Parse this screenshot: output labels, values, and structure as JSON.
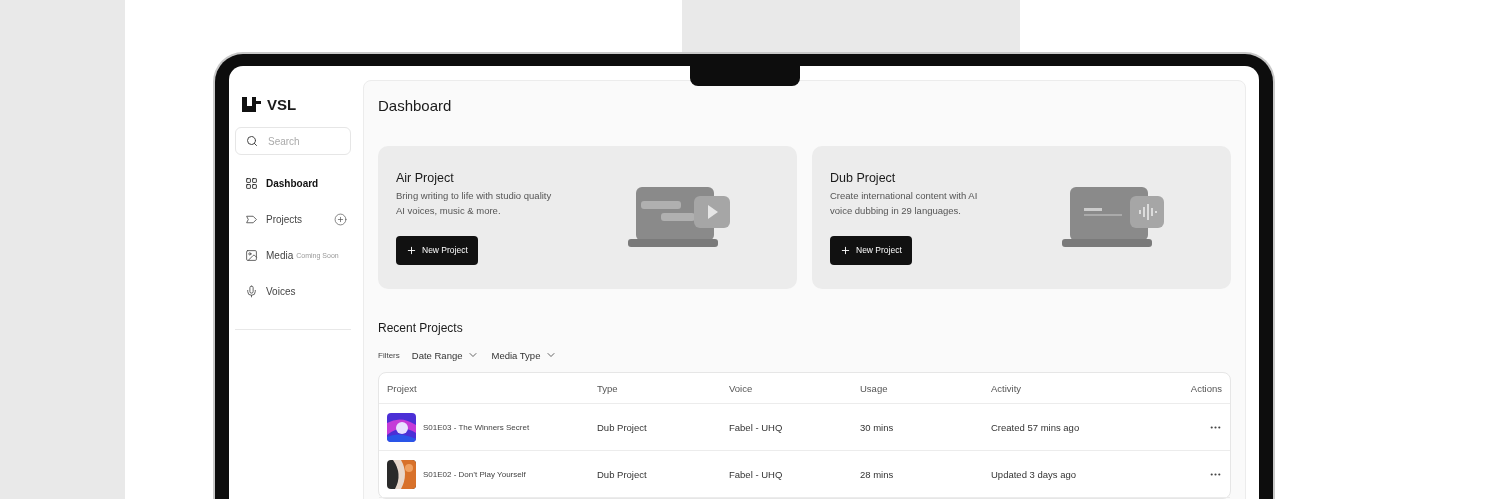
{
  "brand": {
    "name": "VSL"
  },
  "search": {
    "placeholder": "Search"
  },
  "nav": [
    {
      "kind": "dashboard",
      "label": "Dashboard",
      "selected": true,
      "add_button": false
    },
    {
      "kind": "projects",
      "label": "Projects",
      "selected": false,
      "add_button": true
    },
    {
      "kind": "media",
      "label": "Media",
      "badge": "Coming Soon",
      "selected": false,
      "add_button": false
    },
    {
      "kind": "voices",
      "label": "Voices",
      "selected": false,
      "add_button": false
    }
  ],
  "page_title": "Dashboard",
  "cards": [
    {
      "kind": "video",
      "title": "Air Project",
      "description": "Bring writing to life with studio quality AI voices, music & more.",
      "button": "New Project"
    },
    {
      "kind": "audio",
      "title": "Dub Project",
      "description": "Create international content with AI voice dubbing in 29 languages.",
      "button": "New Project"
    }
  ],
  "recent": {
    "title": "Recent Projects",
    "filters_label": "Filters",
    "filters": [
      "Date Range",
      "Media Type"
    ],
    "columns": [
      "Projext",
      "Type",
      "Voice",
      "Usage",
      "Activity",
      "Actions"
    ],
    "rows": [
      {
        "project": "S01E03 - The Winners Secret",
        "type": "Dub Project",
        "voice": "Fabel - UHQ",
        "usage": "30 mins",
        "activity": "Created 57 mins ago"
      },
      {
        "project": "S01E02 - Don’t Play Yourself",
        "type": "Dub Project",
        "voice": "Fabel - UHQ",
        "usage": "28 mins",
        "activity": "Updated 3 days ago"
      }
    ]
  }
}
